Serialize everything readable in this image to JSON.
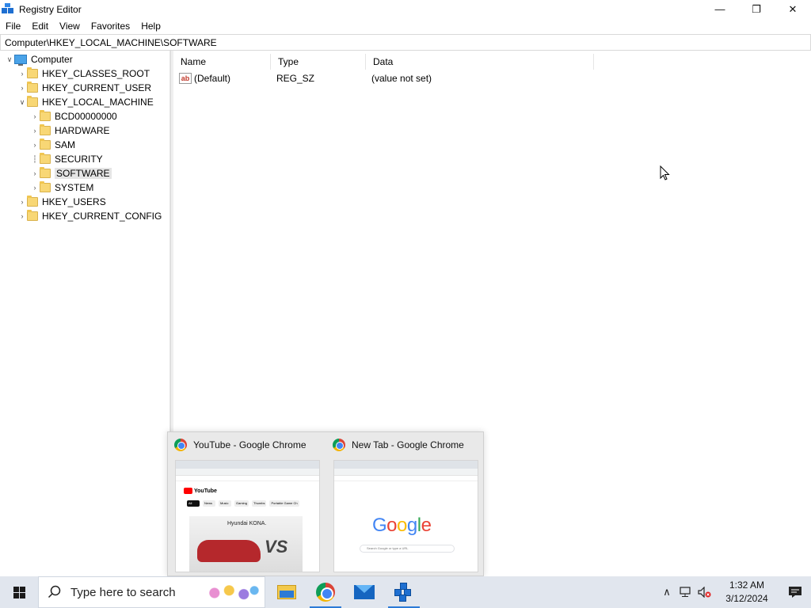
{
  "window": {
    "title": "Registry Editor",
    "controls": {
      "minimize": "—",
      "restore": "❐",
      "close": "✕"
    }
  },
  "menu": [
    "File",
    "Edit",
    "View",
    "Favorites",
    "Help"
  ],
  "address": "Computer\\HKEY_LOCAL_MACHINE\\SOFTWARE",
  "tree": {
    "root": "Computer",
    "hives": {
      "classes_root": "HKEY_CLASSES_ROOT",
      "current_user": "HKEY_CURRENT_USER",
      "local_machine": "HKEY_LOCAL_MACHINE",
      "users": "HKEY_USERS",
      "current_config": "HKEY_CURRENT_CONFIG"
    },
    "local_machine_children": [
      "BCD00000000",
      "HARDWARE",
      "SAM",
      "SECURITY",
      "SOFTWARE",
      "SYSTEM"
    ],
    "selected": "SOFTWARE"
  },
  "list": {
    "columns": {
      "name": "Name",
      "type": "Type",
      "data": "Data"
    },
    "rows": [
      {
        "name": "(Default)",
        "type": "REG_SZ",
        "data": "(value not set)",
        "icon": "ab-icon"
      }
    ]
  },
  "preview": {
    "items": [
      {
        "title": "YouTube - Google Chrome",
        "yt_brand": "YouTube",
        "chips": [
          "All",
          "News",
          "Music",
          "Gaming",
          "Thumbs",
          "Portable Game Ch"
        ],
        "ad_text": "Hyundai KONA.",
        "ad_overlay": "VS"
      },
      {
        "title": "New Tab - Google Chrome",
        "logo": "Google",
        "search_placeholder": "Search Google or type a URL"
      }
    ]
  },
  "taskbar": {
    "search_placeholder": "Type here to search",
    "apps": [
      "file-explorer",
      "google-chrome",
      "mail",
      "registry-editor"
    ],
    "time": "1:32 AM",
    "date": "3/12/2024",
    "tray_icons": [
      "chevron-up-icon",
      "network-icon",
      "volume-muted-icon",
      "notification-icon"
    ]
  },
  "colors": {
    "selection": "#e5e5e5",
    "taskbar": "#e1e6ee",
    "accent": "#2c7ad6"
  }
}
